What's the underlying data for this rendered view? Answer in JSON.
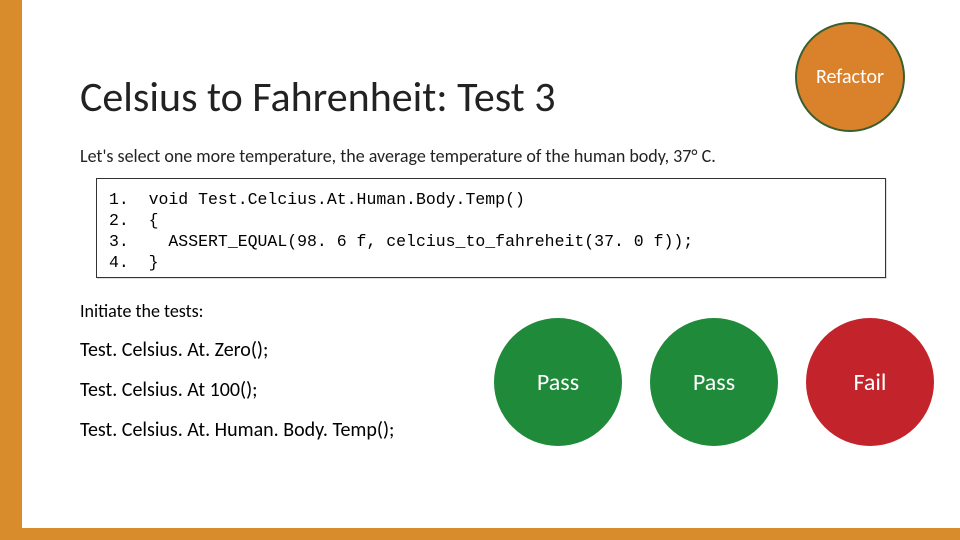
{
  "refactor": {
    "label": "Refactor"
  },
  "title": "Celsius to Fahrenheit: Test 3",
  "intro": "Let's select one more temperature, the average temperature of the human body, 37° C.",
  "code": {
    "l1": "1.  void Test.Celcius.At.Human.Body.Temp()",
    "l2": "2.  {",
    "l3": "3.    ASSERT_EQUAL(98. 6 f, celcius_to_fahreheit(37. 0 f));",
    "l4": "4.  }"
  },
  "initiate": "Initiate the tests:",
  "calls": {
    "c1": "Test. Celsius. At. Zero();",
    "c2": "Test. Celsius. At 100();",
    "c3": "Test. Celsius. At. Human. Body. Temp();"
  },
  "results": {
    "pass1": "Pass",
    "pass2": "Pass",
    "fail": "Fail"
  }
}
